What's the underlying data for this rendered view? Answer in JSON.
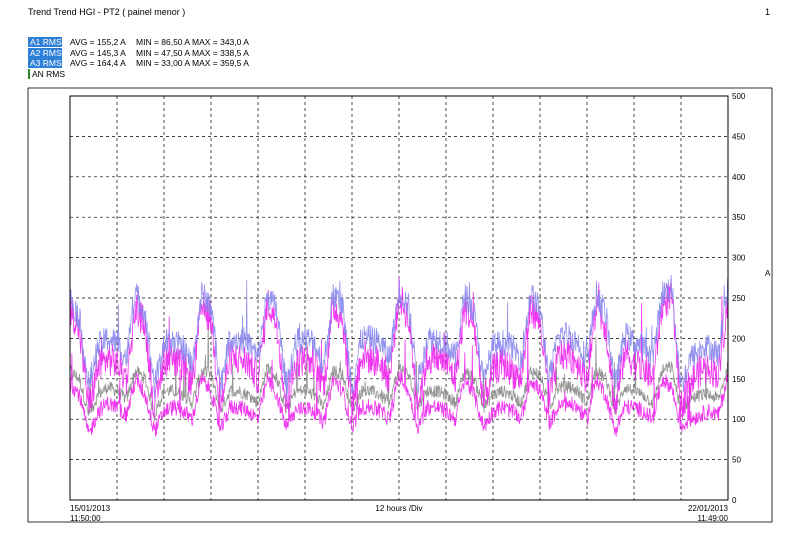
{
  "header": {
    "title": "Trend Trend HGI - PT2 ( painel menor )",
    "page_number": "1"
  },
  "legend": [
    {
      "tag": "A1 RMS",
      "avg": "AVG = 155,2 A",
      "minmax": "MIN = 86,50 A MAX = 343,0 A",
      "color": "#2e7fd8"
    },
    {
      "tag": "A2 RMS",
      "avg": "AVG = 145,3 A",
      "minmax": "MIN = 47,50 A MAX = 338,5 A",
      "color": "#2e7fd8"
    },
    {
      "tag": "A3 RMS",
      "avg": "AVG = 164,4 A",
      "minmax": "MIN = 33,00 A MAX = 359,5 A",
      "color": "#2e7fd8"
    },
    {
      "tag": "AN RMS",
      "avg": "",
      "minmax": "",
      "color": "#ffffff"
    }
  ],
  "chart_data": {
    "type": "line",
    "ylabel": "A",
    "ylim": [
      0,
      500
    ],
    "yticks": [
      "0",
      "50",
      "100",
      "150",
      "200",
      "250",
      "300",
      "350",
      "400",
      "450",
      "500"
    ],
    "x_division_label": "12 hours /Div",
    "x_start": {
      "date": "15/01/2013",
      "time": "11:50:00"
    },
    "x_end": {
      "date": "22/01/2013",
      "time": "11:49:00"
    },
    "grid": true,
    "series": [
      {
        "name": "A1 RMS",
        "color": "#ee22ee",
        "values": [
          240,
          210,
          115,
          165,
          175,
          170,
          150,
          240,
          215,
          110,
          175,
          170,
          165,
          145,
          240,
          225,
          115,
          175,
          175,
          170,
          150,
          245,
          220,
          115,
          170,
          175,
          170,
          140,
          240,
          225,
          115,
          180,
          175,
          170,
          150,
          255,
          225,
          120,
          175,
          175,
          170,
          150,
          240,
          215,
          120,
          160,
          170,
          160,
          150,
          240,
          220,
          125,
          180,
          180,
          170,
          150,
          240,
          215,
          110,
          185,
          170,
          165,
          150,
          240,
          255,
          115,
          145,
          160,
          165,
          155,
          250
        ]
      },
      {
        "name": "A2 RMS",
        "color": "#ee22ee",
        "values": [
          145,
          130,
          80,
          110,
          120,
          115,
          105,
          150,
          130,
          85,
          110,
          115,
          110,
          100,
          150,
          135,
          85,
          115,
          115,
          110,
          100,
          150,
          130,
          90,
          110,
          115,
          110,
          95,
          150,
          135,
          90,
          115,
          115,
          110,
          100,
          155,
          135,
          90,
          115,
          115,
          110,
          100,
          150,
          130,
          90,
          110,
          115,
          110,
          100,
          150,
          135,
          95,
          115,
          120,
          115,
          100,
          150,
          130,
          85,
          115,
          115,
          110,
          100,
          150,
          140,
          90,
          100,
          105,
          110,
          105,
          155
        ]
      },
      {
        "name": "A3 RMS",
        "color": "#8888ee",
        "values": [
          250,
          225,
          140,
          190,
          200,
          195,
          175,
          255,
          230,
          140,
          195,
          195,
          190,
          165,
          255,
          240,
          140,
          200,
          200,
          195,
          175,
          255,
          235,
          140,
          195,
          200,
          195,
          165,
          255,
          240,
          140,
          200,
          200,
          195,
          175,
          260,
          240,
          145,
          200,
          200,
          195,
          175,
          255,
          230,
          145,
          190,
          195,
          190,
          175,
          255,
          235,
          150,
          205,
          205,
          195,
          175,
          255,
          230,
          140,
          205,
          195,
          190,
          175,
          255,
          265,
          140,
          175,
          185,
          190,
          180,
          265
        ]
      },
      {
        "name": "AN RMS",
        "color": "#888888",
        "values": [
          160,
          150,
          105,
          130,
          140,
          135,
          125,
          160,
          150,
          105,
          135,
          135,
          130,
          120,
          160,
          155,
          110,
          135,
          135,
          130,
          120,
          165,
          150,
          110,
          135,
          135,
          130,
          115,
          160,
          155,
          110,
          135,
          135,
          130,
          120,
          165,
          155,
          115,
          135,
          135,
          130,
          120,
          160,
          150,
          115,
          130,
          135,
          130,
          120,
          160,
          155,
          115,
          140,
          140,
          135,
          120,
          160,
          150,
          110,
          140,
          135,
          130,
          120,
          160,
          165,
          110,
          125,
          130,
          130,
          125,
          165
        ]
      }
    ]
  }
}
